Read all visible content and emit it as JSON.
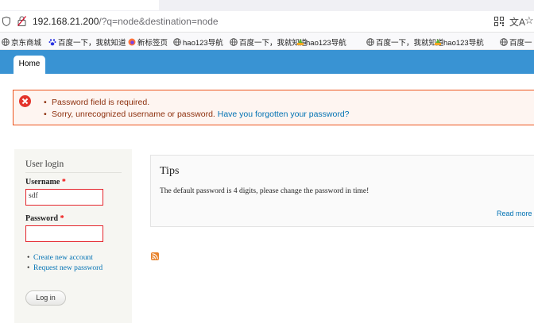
{
  "browser": {
    "url_host": "192.168.21.200",
    "url_path": "/?q=node&destination=node",
    "translate_glyph": "文A",
    "star_glyph": "☆",
    "bookmarks": [
      {
        "label": "京东商城",
        "icon": "globe-icon"
      },
      {
        "label": "百度一下，我就知道",
        "icon": "baidu-paw-icon"
      },
      {
        "label": "新标签页",
        "icon": "firefox-icon"
      },
      {
        "label": "hao123导航",
        "icon": "globe-icon"
      },
      {
        "label": "百度一下，我就知道",
        "icon": "globe-icon"
      },
      {
        "label": "hao123导航",
        "icon": "hao123-icon"
      },
      {
        "label": "百度一下，我就知道",
        "icon": "globe-icon"
      },
      {
        "label": "hao123导航",
        "icon": "hao123-icon"
      },
      {
        "label": "百度一",
        "icon": "globe-icon"
      }
    ]
  },
  "site": {
    "nav": {
      "home_label": "Home"
    },
    "colors": {
      "header": "#3993d3",
      "error_border": "#ed541d",
      "error_text": "#8c2e0b",
      "link": "#0071b3"
    },
    "messages": {
      "line1": "Password field is required.",
      "line2_text": "Sorry, unrecognized username or password.",
      "line2_link": "Have you forgotten your password?"
    },
    "login": {
      "title": "User login",
      "username_label": "Username",
      "username_value": "sdf",
      "password_label": "Password",
      "password_value": "",
      "required_mark": "*",
      "links": [
        "Create new account",
        "Request new password"
      ],
      "submit_label": "Log in"
    },
    "tips": {
      "title": "Tips",
      "body": "The default password is 4 digits, please change the password in time!",
      "read_more": "Read more"
    }
  }
}
